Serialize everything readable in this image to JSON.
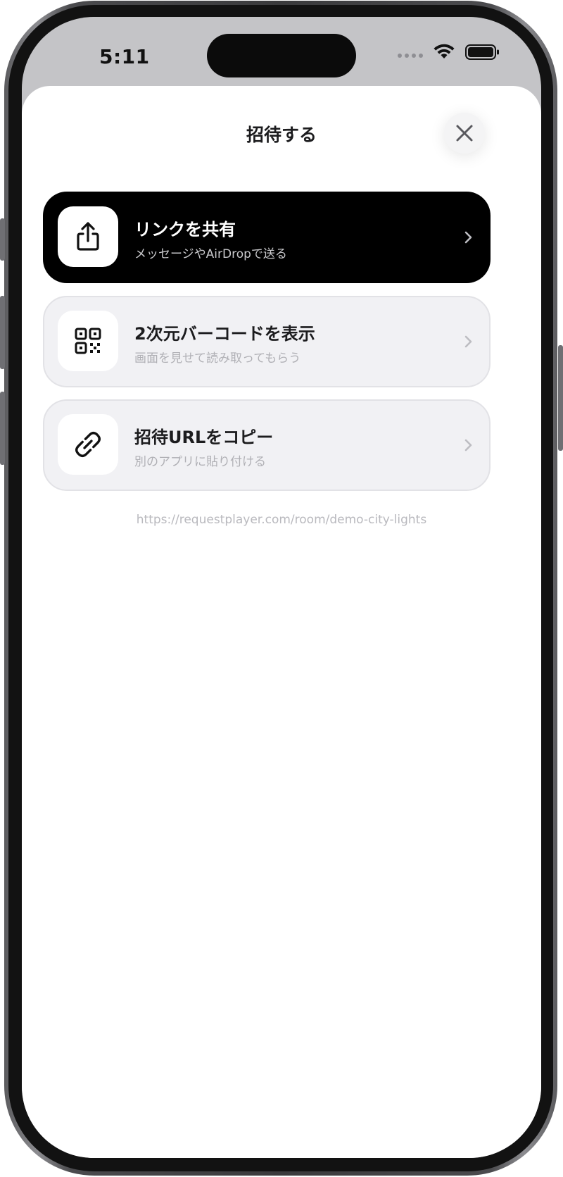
{
  "status_bar": {
    "time": "5:11",
    "icons": [
      "signal-dots-icon",
      "wifi-icon",
      "battery-icon"
    ]
  },
  "sheet": {
    "title": "招待する",
    "close_icon": "close-icon"
  },
  "options": [
    {
      "icon": "share-icon",
      "title": "リンクを共有",
      "subtitle": "メッセージやAirDropで送る",
      "style": "primary"
    },
    {
      "icon": "qr-code-icon",
      "title": "2次元バーコードを表示",
      "subtitle": "画面を見せて読み取ってもらう",
      "style": "secondary"
    },
    {
      "icon": "link-icon",
      "title": "招待URLをコピー",
      "subtitle": "別のアプリに貼り付ける",
      "style": "secondary"
    }
  ],
  "invite_url": "https://requestplayer.com/room/demo-city-lights",
  "colors": {
    "primary_card": "#000000",
    "secondary_card": "#f1f1f4",
    "muted_text": "#b9b9be"
  }
}
